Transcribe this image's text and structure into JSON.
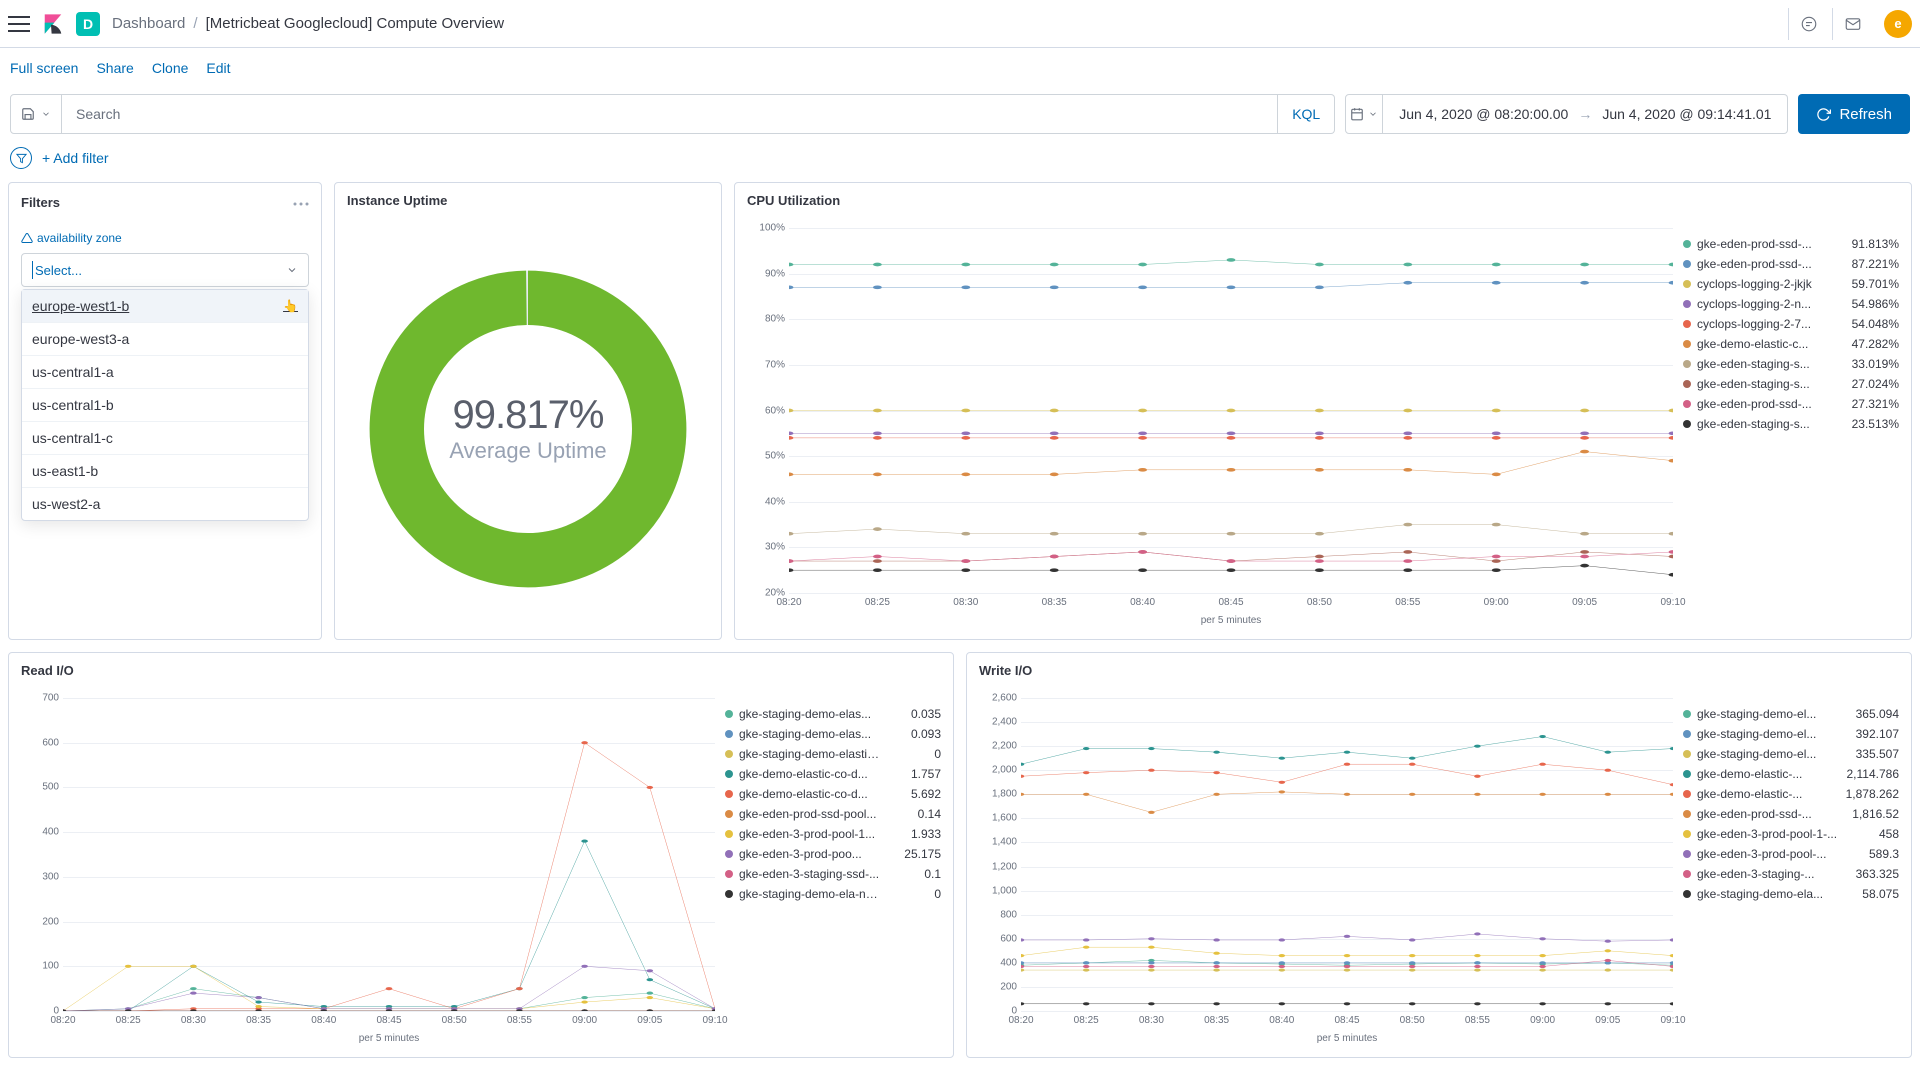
{
  "header": {
    "app_letter": "D",
    "crumb1": "Dashboard",
    "crumb2": "[Metricbeat Googlecloud] Compute Overview",
    "avatar": "e"
  },
  "actions": {
    "fullscreen": "Full screen",
    "share": "Share",
    "clone": "Clone",
    "edit": "Edit"
  },
  "query": {
    "search_placeholder": "Search",
    "kql_label": "KQL",
    "date_from": "Jun 4, 2020 @ 08:20:00.00",
    "date_to": "Jun 4, 2020 @ 09:14:41.01",
    "refresh": "Refresh",
    "add_filter": "+ Add filter"
  },
  "filters_panel": {
    "title": "Filters",
    "field_label": "availability zone",
    "placeholder": "Select...",
    "options": [
      "europe-west1-b",
      "europe-west3-a",
      "us-central1-a",
      "us-central1-b",
      "us-central1-c",
      "us-east1-b",
      "us-west2-a"
    ]
  },
  "uptime_panel": {
    "title": "Instance Uptime",
    "value": "99.817%",
    "label": "Average Uptime"
  },
  "cpu_panel": {
    "title": "CPU Utilization",
    "y_ticks": [
      "100%",
      "90%",
      "80%",
      "70%",
      "60%",
      "50%",
      "40%",
      "30%",
      "20%"
    ],
    "x_ticks": [
      "08:20",
      "08:25",
      "08:30",
      "08:35",
      "08:40",
      "08:45",
      "08:50",
      "08:55",
      "09:00",
      "09:05",
      "09:10"
    ],
    "axis_label": "per 5 minutes",
    "legend": [
      {
        "c": "#54b399",
        "n": "gke-eden-prod-ssd-...",
        "v": "91.813%"
      },
      {
        "c": "#6092c0",
        "n": "gke-eden-prod-ssd-...",
        "v": "87.221%"
      },
      {
        "c": "#d6bf57",
        "n": "cyclops-logging-2-jkjk",
        "v": "59.701%"
      },
      {
        "c": "#9170b8",
        "n": "cyclops-logging-2-n...",
        "v": "54.986%"
      },
      {
        "c": "#e7664c",
        "n": "cyclops-logging-2-7...",
        "v": "54.048%"
      },
      {
        "c": "#da8b45",
        "n": "gke-demo-elastic-c...",
        "v": "47.282%"
      },
      {
        "c": "#b9a888",
        "n": "gke-eden-staging-s...",
        "v": "33.019%"
      },
      {
        "c": "#aa6556",
        "n": "gke-eden-staging-s...",
        "v": "27.024%"
      },
      {
        "c": "#d36086",
        "n": "gke-eden-prod-ssd-...",
        "v": "27.321%"
      },
      {
        "c": "#333333",
        "n": "gke-eden-staging-s...",
        "v": "23.513%"
      }
    ]
  },
  "readio_panel": {
    "title": "Read I/O",
    "y_ticks": [
      "700",
      "600",
      "500",
      "400",
      "300",
      "200",
      "100",
      "0"
    ],
    "x_ticks": [
      "08:20",
      "08:25",
      "08:30",
      "08:35",
      "08:40",
      "08:45",
      "08:50",
      "08:55",
      "09:00",
      "09:05",
      "09:10"
    ],
    "axis_label": "per 5 minutes",
    "legend": [
      {
        "c": "#54b399",
        "n": "gke-staging-demo-elas...",
        "v": "0.035"
      },
      {
        "c": "#6092c0",
        "n": "gke-staging-demo-elas...",
        "v": "0.093"
      },
      {
        "c": "#d6bf57",
        "n": "gke-staging-demo-elastic-d...",
        "v": "0"
      },
      {
        "c": "#2c9490",
        "n": "gke-demo-elastic-co-d...",
        "v": "1.757"
      },
      {
        "c": "#e7664c",
        "n": "gke-demo-elastic-co-d...",
        "v": "5.692"
      },
      {
        "c": "#da8b45",
        "n": "gke-eden-prod-ssd-pool...",
        "v": "0.14"
      },
      {
        "c": "#e5c13f",
        "n": "gke-eden-3-prod-pool-1...",
        "v": "1.933"
      },
      {
        "c": "#9170b8",
        "n": "gke-eden-3-prod-poo...",
        "v": "25.175"
      },
      {
        "c": "#d36086",
        "n": "gke-eden-3-staging-ssd-...",
        "v": "0.1"
      },
      {
        "c": "#333333",
        "n": "gke-staging-demo-ela-nap-...",
        "v": "0"
      }
    ]
  },
  "writeio_panel": {
    "title": "Write I/O",
    "y_ticks": [
      "2,600",
      "2,400",
      "2,200",
      "2,000",
      "1,800",
      "1,600",
      "1,400",
      "1,200",
      "1,000",
      "800",
      "600",
      "400",
      "200",
      "0"
    ],
    "x_ticks": [
      "08:20",
      "08:25",
      "08:30",
      "08:35",
      "08:40",
      "08:45",
      "08:50",
      "08:55",
      "09:00",
      "09:05",
      "09:10"
    ],
    "axis_label": "per 5 minutes",
    "legend": [
      {
        "c": "#54b399",
        "n": "gke-staging-demo-el...",
        "v": "365.094"
      },
      {
        "c": "#6092c0",
        "n": "gke-staging-demo-el...",
        "v": "392.107"
      },
      {
        "c": "#d6bf57",
        "n": "gke-staging-demo-el...",
        "v": "335.507"
      },
      {
        "c": "#2c9490",
        "n": "gke-demo-elastic-...",
        "v": "2,114.786"
      },
      {
        "c": "#e7664c",
        "n": "gke-demo-elastic-...",
        "v": "1,878.262"
      },
      {
        "c": "#da8b45",
        "n": "gke-eden-prod-ssd-...",
        "v": "1,816.52"
      },
      {
        "c": "#e5c13f",
        "n": "gke-eden-3-prod-pool-1-...",
        "v": "458"
      },
      {
        "c": "#9170b8",
        "n": "gke-eden-3-prod-pool-...",
        "v": "589.3"
      },
      {
        "c": "#d36086",
        "n": "gke-eden-3-staging-...",
        "v": "363.325"
      },
      {
        "c": "#333333",
        "n": "gke-staging-demo-ela...",
        "v": "58.075"
      }
    ]
  },
  "chart_data": [
    {
      "type": "gauge",
      "title": "Instance Uptime",
      "value": 99.817,
      "label": "Average Uptime"
    },
    {
      "type": "line",
      "title": "CPU Utilization",
      "xlabel": "per 5 minutes",
      "ylabel": "%",
      "ylim": [
        20,
        100
      ],
      "categories": [
        "08:20",
        "08:25",
        "08:30",
        "08:35",
        "08:40",
        "08:45",
        "08:50",
        "08:55",
        "09:00",
        "09:05",
        "09:10"
      ],
      "series": [
        {
          "name": "gke-eden-prod-ssd-...",
          "values": [
            92,
            92,
            92,
            92,
            92,
            93,
            92,
            92,
            92,
            92,
            92
          ]
        },
        {
          "name": "gke-eden-prod-ssd-...",
          "values": [
            87,
            87,
            87,
            87,
            87,
            87,
            87,
            88,
            88,
            88,
            88
          ]
        },
        {
          "name": "cyclops-logging-2-jkjk",
          "values": [
            60,
            60,
            60,
            60,
            60,
            60,
            60,
            60,
            60,
            60,
            60
          ]
        },
        {
          "name": "cyclops-logging-2-n...",
          "values": [
            55,
            55,
            55,
            55,
            55,
            55,
            55,
            55,
            55,
            55,
            55
          ]
        },
        {
          "name": "cyclops-logging-2-7...",
          "values": [
            54,
            54,
            54,
            54,
            54,
            54,
            54,
            54,
            54,
            54,
            54
          ]
        },
        {
          "name": "gke-demo-elastic-c...",
          "values": [
            46,
            46,
            46,
            46,
            47,
            47,
            47,
            47,
            46,
            51,
            49
          ]
        },
        {
          "name": "gke-eden-staging-s...",
          "values": [
            33,
            34,
            33,
            33,
            33,
            33,
            33,
            35,
            35,
            33,
            33
          ]
        },
        {
          "name": "gke-eden-staging-s...",
          "values": [
            27,
            27,
            27,
            28,
            29,
            27,
            28,
            29,
            27,
            29,
            28
          ]
        },
        {
          "name": "gke-eden-prod-ssd-...",
          "values": [
            27,
            28,
            27,
            28,
            29,
            27,
            27,
            27,
            28,
            28,
            29
          ]
        },
        {
          "name": "gke-eden-staging-s...",
          "values": [
            25,
            25,
            25,
            25,
            25,
            25,
            25,
            25,
            25,
            26,
            24
          ]
        }
      ]
    },
    {
      "type": "line",
      "title": "Read I/O",
      "xlabel": "per 5 minutes",
      "ylim": [
        0,
        700
      ],
      "categories": [
        "08:20",
        "08:25",
        "08:30",
        "08:35",
        "08:40",
        "08:45",
        "08:50",
        "08:55",
        "09:00",
        "09:05",
        "09:10"
      ],
      "series": [
        {
          "name": "gke-staging-demo-elas...",
          "values": [
            0,
            5,
            50,
            30,
            5,
            5,
            5,
            5,
            30,
            40,
            5
          ]
        },
        {
          "name": "gke-staging-demo-elas...",
          "values": [
            0,
            0,
            0,
            0,
            0,
            0,
            0,
            0,
            0,
            0,
            0
          ]
        },
        {
          "name": "gke-staging-demo-elastic-d...",
          "values": [
            0,
            0,
            0,
            0,
            0,
            0,
            0,
            0,
            0,
            0,
            0
          ]
        },
        {
          "name": "gke-demo-elastic-co-d...",
          "values": [
            0,
            0,
            100,
            20,
            10,
            10,
            10,
            50,
            380,
            70,
            5
          ]
        },
        {
          "name": "gke-demo-elastic-co-d...",
          "values": [
            0,
            0,
            5,
            5,
            5,
            50,
            5,
            50,
            600,
            500,
            5
          ]
        },
        {
          "name": "gke-eden-prod-ssd-pool...",
          "values": [
            0,
            0,
            0,
            0,
            0,
            0,
            0,
            0,
            0,
            0,
            0
          ]
        },
        {
          "name": "gke-eden-3-prod-pool-1...",
          "values": [
            0,
            100,
            100,
            10,
            5,
            5,
            5,
            5,
            20,
            30,
            5
          ]
        },
        {
          "name": "gke-eden-3-prod-poo...",
          "values": [
            0,
            5,
            40,
            30,
            5,
            5,
            5,
            5,
            100,
            90,
            5
          ]
        },
        {
          "name": "gke-eden-3-staging-ssd-...",
          "values": [
            0,
            0,
            0,
            0,
            0,
            0,
            0,
            0,
            0,
            0,
            0
          ]
        },
        {
          "name": "gke-staging-demo-ela-nap-...",
          "values": [
            0,
            0,
            0,
            0,
            0,
            0,
            0,
            0,
            0,
            0,
            0
          ]
        }
      ]
    },
    {
      "type": "line",
      "title": "Write I/O",
      "xlabel": "per 5 minutes",
      "ylim": [
        0,
        2600
      ],
      "categories": [
        "08:20",
        "08:25",
        "08:30",
        "08:35",
        "08:40",
        "08:45",
        "08:50",
        "08:55",
        "09:00",
        "09:05",
        "09:10"
      ],
      "series": [
        {
          "name": "gke-staging-demo-el...",
          "values": [
            380,
            400,
            420,
            400,
            390,
            380,
            390,
            400,
            390,
            400,
            380
          ]
        },
        {
          "name": "gke-staging-demo-el...",
          "values": [
            400,
            400,
            400,
            400,
            400,
            400,
            400,
            400,
            400,
            400,
            400
          ]
        },
        {
          "name": "gke-staging-demo-el...",
          "values": [
            340,
            340,
            340,
            340,
            340,
            340,
            340,
            340,
            340,
            340,
            340
          ]
        },
        {
          "name": "gke-demo-elastic-...",
          "values": [
            2050,
            2180,
            2180,
            2150,
            2100,
            2150,
            2100,
            2200,
            2280,
            2150,
            2180
          ]
        },
        {
          "name": "gke-demo-elastic-...",
          "values": [
            1950,
            1980,
            2000,
            1980,
            1900,
            2050,
            2050,
            1950,
            2050,
            2000,
            1880
          ]
        },
        {
          "name": "gke-eden-prod-ssd-...",
          "values": [
            1800,
            1800,
            1650,
            1800,
            1820,
            1800,
            1800,
            1800,
            1800,
            1800,
            1800
          ]
        },
        {
          "name": "gke-eden-3-prod-pool-1-...",
          "values": [
            460,
            530,
            530,
            480,
            460,
            460,
            460,
            460,
            460,
            500,
            460
          ]
        },
        {
          "name": "gke-eden-3-prod-pool-...",
          "values": [
            590,
            590,
            600,
            590,
            590,
            620,
            590,
            640,
            600,
            580,
            590
          ]
        },
        {
          "name": "gke-eden-3-staging-...",
          "values": [
            370,
            370,
            370,
            370,
            370,
            370,
            370,
            370,
            370,
            420,
            370
          ]
        },
        {
          "name": "gke-staging-demo-ela...",
          "values": [
            60,
            60,
            60,
            60,
            60,
            60,
            60,
            60,
            60,
            60,
            60
          ]
        }
      ]
    }
  ]
}
